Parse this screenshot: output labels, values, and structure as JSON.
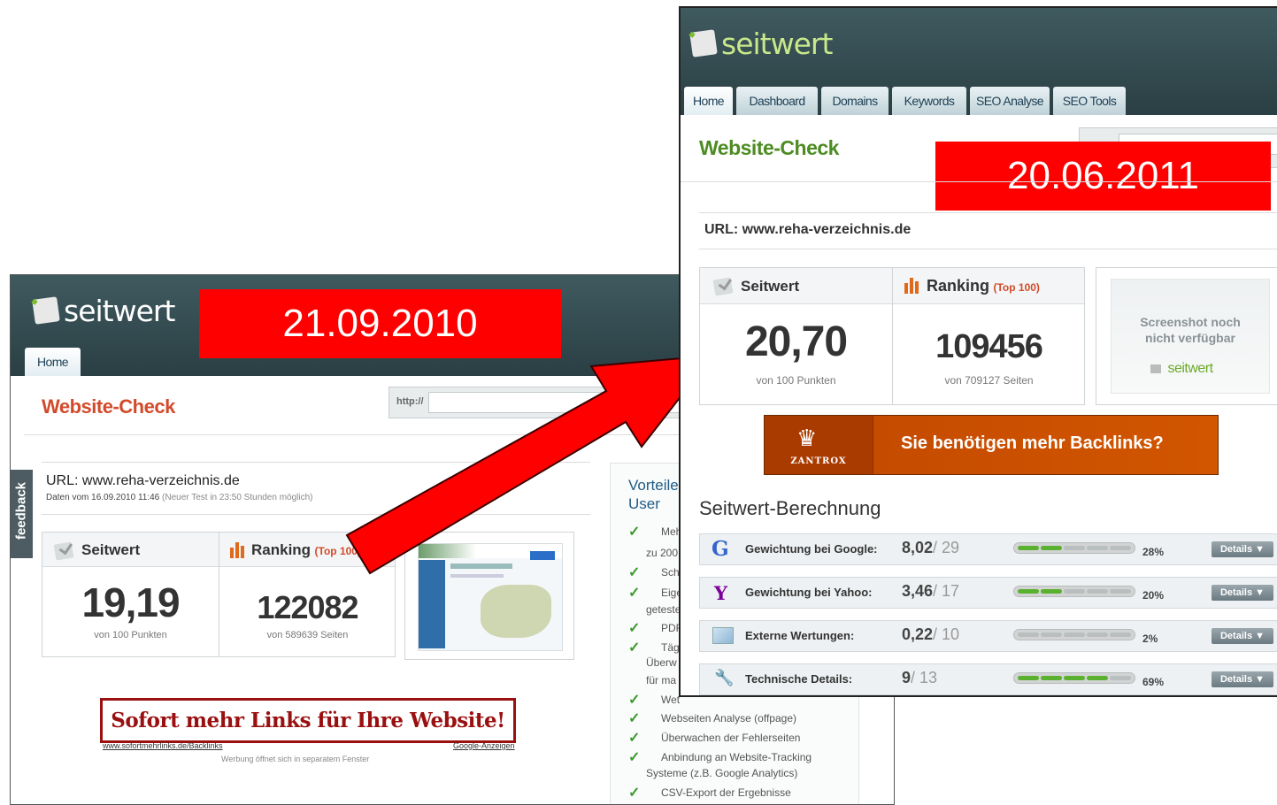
{
  "old": {
    "logo": "seitwert",
    "date": "21.09.2010",
    "tab_home": "Home",
    "heading": "Website-Check",
    "http_label": "http://",
    "feedback": "feedback",
    "url_line": "URL: www.reha-verzeichnis.de",
    "data_line": "Daten vom 16.09.2010 11:46",
    "data_hint": "(Neuer Test in 23:50 Stunden möglich)",
    "seitwert_label": "Seitwert",
    "ranking_label": "Ranking",
    "ranking_top": "(Top 100)",
    "seitwert_value": "19,19",
    "seitwert_sub": "von 100 Punkten",
    "ranking_value": "122082",
    "ranking_sub": "von 589639 Seiten",
    "ad_text": "Sofort mehr Links für Ihre Website!",
    "ad_url": "www.sofortmehrlinks.de/Backlinks",
    "ad_google": "Google-Anzeigen",
    "ad_note": "Werbung öffnet sich in separatem Fenster",
    "side_title_1": "Vorteile",
    "side_title_2": "User",
    "side_items": [
      {
        "text": "Meh"
      },
      {
        "text": "zu 200"
      },
      {
        "text": "Sch"
      },
      {
        "text": "Eige"
      },
      {
        "text": "geteste"
      },
      {
        "text": "PDF"
      },
      {
        "text": "Täg"
      },
      {
        "text": "Überw"
      },
      {
        "text": "für ma"
      },
      {
        "text": "Wet"
      },
      {
        "text": "Webseiten Analyse (offpage)"
      },
      {
        "text": "Überwachen der Fehlerseiten"
      },
      {
        "text": "Anbindung an Website-Tracking"
      },
      {
        "text": "Systeme (z.B. Google Analytics)"
      },
      {
        "text": "CSV-Export der Ergebnisse"
      }
    ]
  },
  "new": {
    "logo": "seitwert",
    "date": "20.06.2011",
    "tabs": [
      "Home",
      "Dashboard",
      "Domains",
      "Keywords",
      "SEO Analyse",
      "SEO Tools"
    ],
    "heading": "Website-Check",
    "url_line": "URL: www.reha-verzeichnis.de",
    "seitwert_label": "Seitwert",
    "ranking_label": "Ranking",
    "ranking_top": "(Top 100)",
    "seitwert_value": "20,70",
    "seitwert_sub": "von 100 Punkten",
    "ranking_value": "109456",
    "ranking_sub": "von 709127 Seiten",
    "screenshot_1": "Screenshot noch",
    "screenshot_2": "nicht verfügbar",
    "screenshot_logo": "seitwert",
    "banner_brand": "ZANTROX",
    "banner_text": "Sie benötigen mehr Backlinks?",
    "calc_title": "Seitwert-Berechnung",
    "details_label": "Details ▼",
    "rows": [
      {
        "icon": "G",
        "label": "Gewichtung bei Google:",
        "score": "8,02",
        "max": "/ 29",
        "pct": "28%",
        "filled": 2
      },
      {
        "icon": "Y",
        "label": "Gewichtung bei Yahoo:",
        "score": "3,46",
        "max": "/ 17",
        "pct": "20%",
        "filled": 2
      },
      {
        "icon": "",
        "label": "Externe Wertungen:",
        "score": "0,22",
        "max": "/ 10",
        "pct": "2%",
        "filled": 0
      },
      {
        "icon": "",
        "label": "Technische Details:",
        "score": "9",
        "max": "/ 13",
        "pct": "69%",
        "filled": 4
      }
    ]
  }
}
